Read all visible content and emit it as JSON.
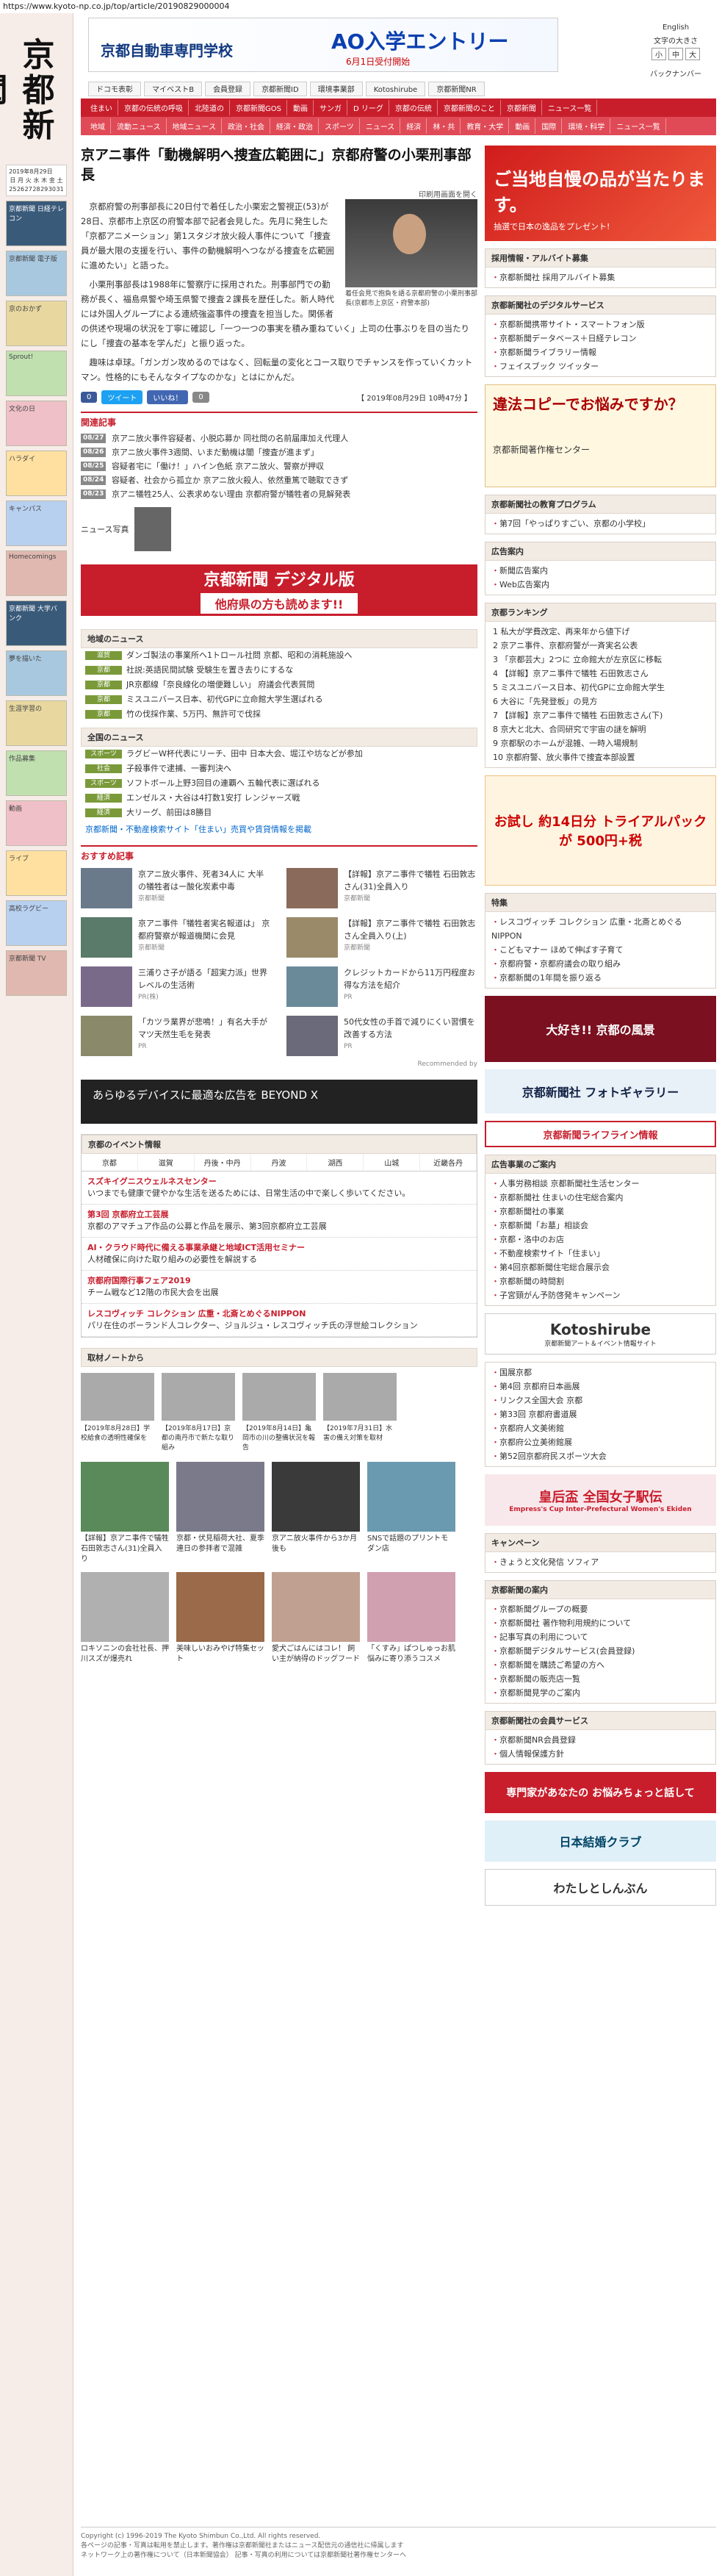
{
  "url": "https://www.kyoto-np.co.jp/top/article/20190829000004",
  "logo": "京都新聞",
  "left": {
    "date": "2019年8月29日",
    "boxes": [
      "京都新聞 日経テレコン",
      "京都新聞 電子版",
      "京のおかず",
      "Sprout!",
      "文化の日",
      "ハラダイ",
      "キャンパス",
      "Homecomings",
      "京都新聞 大学バンク",
      "夢を描いた",
      "生涯学習の",
      "作品募集",
      "動画",
      "ライブ",
      "高校ラグビー",
      "京都新聞 TV"
    ]
  },
  "header": {
    "school": "京都自動車専門学校",
    "ao": "AO入学エントリー",
    "ao_sub": "6月1日受付開始",
    "lang": "English",
    "lang2": "文字の大きさ",
    "backnumber": "バックナンバー"
  },
  "nav1": [
    "ドコモ表彰",
    "マイベストB",
    "会員登録",
    "京都新聞ID",
    "環境事業部",
    "Kotoshirube",
    "京都新聞NR"
  ],
  "nav2": [
    "住まい",
    "京都の伝統の呼吸",
    "北陸道の",
    "京都新聞GOS",
    "動画",
    "サンガ",
    "D リーグ",
    "京都の伝統",
    "京都新聞のこと",
    "京都新聞",
    "ニュース一覧"
  ],
  "nav3": [
    "地域",
    "流動ニュース",
    "地域ニュース",
    "政治・社会",
    "経済・政治",
    "スポーツ",
    "ニュース",
    "経済",
    "林・共",
    "教育・大学",
    "動画",
    "国際",
    "環境・科学",
    "ニュース一覧"
  ],
  "article": {
    "title": "京アニ事件「動機解明へ捜査広範囲に」京都府警の小栗刑事部長",
    "print": "印刷用画面を開く",
    "photo_caption": "着任会見で抱負を語る京都府警の小栗刑事部長(京都市上京区・府警本部)",
    "paragraphs": [
      "京都府警の刑事部長に20日付で着任した小栗宏之警視正(53)が28日、京都市上京区の府警本部で記者会見した。先月に発生した「京都アニメーション」第1スタジオ放火殺人事件について「捜査員が最大限の支援を行い、事件の動機解明へつながる捜査を広範囲に進めたい」と語った。",
      "小栗刑事部長は1988年に警察庁に採用された。刑事部門での勤務が長く、福島県警や埼玉県警で捜査２課長を歴任した。新人時代には外国人グループによる連続強盗事件の捜査を担当した。関係者の供述や現場の状況を丁寧に確認し「一つ一つの事実を積み重ねていく」上司の仕事ぶりを目の当たりにし「捜査の基本を学んだ」と振り返った。",
      "趣味は卓球。「ガンガン攻めるのではなく、回転量の変化とコース取りでチャンスを作っていくカットマン。性格的にもそんなタイプなのかな」とはにかんだ。"
    ],
    "share": [
      "0",
      "ツイート",
      "いいね！",
      "0"
    ],
    "timestamp": "【 2019年08月29日 10時47分 】",
    "related_head": "関連記事",
    "related": [
      {
        "tag": "08/27",
        "text": "京アニ放火事件容疑者、小脱応募か 同社問の名前届庫加え代理人"
      },
      {
        "tag": "08/26",
        "text": "京アニ放火事件3週間、いまだ動機は闇「捜査が進まず」"
      },
      {
        "tag": "08/25",
        "text": "容疑者宅に「働け！」ハイン色紙 京アニ放火、警察が押収"
      },
      {
        "tag": "08/24",
        "text": "容疑者、社会から孤立か 京アニ放火殺人、依然重篤で聴取できず"
      },
      {
        "tag": "08/23",
        "text": "京アニ犠牲25人、公表求めない理由 京都府警が犠牲者の見解発表"
      }
    ],
    "news_person": "ニュース写真"
  },
  "digital_banner": {
    "a": "京都新聞 デジタル版",
    "b": "他府県の方も読めます!!"
  },
  "local_news": {
    "head": "地域のニュース",
    "items": [
      {
        "tag": "滋賀",
        "text": "ダンゴ製法の事業所へ1トロール社問 京都、昭和の消耗施設へ"
      },
      {
        "tag": "京都",
        "text": "社説:英語民間試験 受験生を置き去りにするな"
      },
      {
        "tag": "京都",
        "text": "JR京都線「奈良線化の増便難しい」 府議会代表質問"
      },
      {
        "tag": "京都",
        "text": "ミスユニバース日本、初代GPに立命館大学生選ばれる"
      },
      {
        "tag": "京都",
        "text": "竹の伐採作業、5万円、無許可で伐採"
      }
    ],
    "head2": "全国のニュース",
    "items2": [
      {
        "tag": "スポーツ",
        "text": "ラグビーW杯代表にリーチ、田中 日本大会、堀江や坊などが参加"
      },
      {
        "tag": "社会",
        "text": "子殺事件で逮捕、一審判決へ"
      },
      {
        "tag": "スポーツ",
        "text": "ソフトボール上野3回目の連覇へ 五輪代表に選ばれる"
      },
      {
        "tag": "経済",
        "text": "エンゼルス・大谷は4打数1安打 レンジャーズ戦"
      },
      {
        "tag": "経済",
        "text": "大リーグ、前田は8勝目"
      }
    ],
    "more": "京都新聞・不動産検索サイト「住まい」売買や賃貸情報を掲載"
  },
  "recommend": {
    "head": "おすすめ記事",
    "items": [
      {
        "text": "京アニ放火事件、死者34人に 大半の犠牲者はー酸化炭素中毒",
        "src": "京都新聞"
      },
      {
        "text": "【詳報】京アニ事件で犠牲 石田敦志さん(31)全員入り",
        "src": "京都新聞"
      },
      {
        "text": "京アニ事件「犠牲者実名報道は」 京都府警察が報道機関に会見",
        "src": "京都新聞"
      },
      {
        "text": "【詳報】京アニ事件で犠牲 石田敦志さん全員入り(上)",
        "src": "京都新聞"
      },
      {
        "text": "三浦りさ子が語る「超実力派」世界レベルの生活術",
        "src": "PR(株)"
      },
      {
        "text": "クレジットカードから11万円程度お得な方法を紹介",
        "src": "PR"
      },
      {
        "text": "「カツラ業界が悲鳴！」有名大手がマツ天然生毛を発表",
        "src": "PR"
      },
      {
        "text": "50代女性の手首で減りにくい習慣を改善する方法",
        "src": "PR"
      }
    ],
    "recommended_by": "Recommended by"
  },
  "beyond": "あらゆるデバイスに最適な広告を BEYOND X",
  "events": {
    "head": "京都のイベント情報",
    "tabs": [
      "京都",
      "滋賀",
      "丹後・中丹",
      "丹波",
      "湖西",
      "山城",
      "近畿各丹"
    ],
    "items": [
      {
        "h": "スズキイグニスウェルネスセンター",
        "t": "いつまでも健康で健やかな生活を送るためには、日常生活の中で楽しく歩いてください。"
      },
      {
        "h": "第3回 京都府立工芸展",
        "t": "京都のアマチュア作品の公募と作品を展示、第3回京都府立工芸展"
      },
      {
        "h": "AI・クラウド時代に備える事業承継と地域ICT活用セミナー",
        "t": "人材確保に向けた取り組みの必要性を解説する"
      },
      {
        "h": "京都府国際行事フェア2019",
        "t": "チーム戦など12階の市民大会を出展"
      },
      {
        "h": "レスコヴィッチ コレクション 広重・北斎とめぐるNIPPON",
        "t": "パリ在住のボーランド人コレクター、ジョルジュ・レスコヴィッチ氏の浮世絵コレクション"
      }
    ]
  },
  "notes": {
    "head": "取材ノートから",
    "items": [
      "【2019年8月28日】学校給食の透明性確保を",
      "【2019年8月17日】京都の南丹市で新たな取り組み",
      "【2019年8月14日】亀岡市の川の整備状況を報告",
      "【2019年7月31日】水害の備え対策を取材"
    ]
  },
  "grid": [
    "【詳報】京アニ事件で犠牲 石田敦志さん(31)全員入り",
    "京都・伏見稲荷大社、夏季連日の参拝者で混雑",
    "京アニ放火事件から3か月後も",
    "SNSで話題のプリントモダン店",
    "ロキソニンの会社社長、押川スズが爆売れ",
    "美味しいおみやげ特集セット",
    "愛犬ごはんにはコレ！ 飼い主が納得のドッグフード",
    "「くすみ」ぱつしゅっお肌悩みに寄り添うコスメ"
  ],
  "sidebar": {
    "ad1_title": "ご当地自慢の品が当たります。",
    "ad1_sub": "抽選で日本の逸品をプレゼント!",
    "recruit_head": "採用情報・アルバイト募集",
    "recruit": [
      "京都新聞社 採用アルバイト募集"
    ],
    "digital_head": "京都新聞社のデジタルサービス",
    "digital": [
      "京都新聞携帯サイト・スマートフォン版",
      "京都新聞データベース＋日経テレコン",
      "京都新聞ライブラリー情報",
      "フェイスブック ツイッター"
    ],
    "copy_title": "違法コピーでお悩みですか？",
    "copy_sub": "京都新聞著作権センター",
    "edu_head": "京都新聞社の教育プログラム",
    "edu": [
      "第7回「やっぱりすごい、京都の小学校」"
    ],
    "ad_head": "広告案内",
    "ad": [
      "新聞広告案内",
      "Web広告案内"
    ],
    "rank_head": "京都ランキング",
    "rank": [
      "1 私大が学費改定、再来年から値下げ",
      "2 京アニ事件、京都府警が一斉実名公表",
      "3 「京都芸大」2つに 立命館大が左京区に移転",
      "4 【詳報】京アニ事件で犠牲 石田敦志さん",
      "5 ミスユニバース日本、初代GPに立命館大学生",
      "6 大谷に「先発登板」の見方",
      "7 【詳報】京アニ事件で犠牲 石田敦志さん(下)",
      "8 京大と北大、合同研究で宇宙の謎を解明",
      "9 京都駅のホームが混雑、一時入場規制",
      "10 京都府警、放火事件で捜査本部設置"
    ],
    "pharma_ad": "お試し 約14日分 トライアルパックが 500円+税",
    "special_head": "特集",
    "special": [
      "レスコヴィッチ コレクション 広重・北斎とめぐるNIPPON",
      "こどもマナー ほめて伸ばす子育て",
      "京都府警・京都府議会の取り組み",
      "京都新聞の1年間を振り返る"
    ],
    "photo_contest": "大好き!! 京都の風景",
    "photo_gallery": "京都新聞社 フォトギャラリー",
    "life_ban": "京都新聞ライフライン情報",
    "info_head": "広告事業のご案内",
    "info": [
      "人事労務相談 京都新聞社生活センター",
      "京都新聞社 住まいの住宅総合案内",
      "京都新聞社の事業",
      "京都新聞「お墓」相談会",
      "京都・洛中のお店",
      "不動産検索サイト「住まい」",
      "第4回京都新聞住宅総合展示会",
      "京都新聞の時間割",
      "子宮頸がん予防啓発キャンペーン"
    ],
    "kotoshirube": "Kotoshirube",
    "kotoshirube_sub": "京都新聞アート＆イベント情報サイト",
    "kt_list": [
      "国展京都",
      "第4回 京都府日本画展",
      "リンクス全国大会 京都",
      "第33回 京都府書道展",
      "京都府人文美術館",
      "京都府公立美術館展",
      "第52回京都府民スポーツ大会"
    ],
    "ekiden": "皇后盃 全国女子駅伝",
    "ekiden_sub": "Empress's Cup Inter-Prefectural Women's Ekiden",
    "campaign_head": "キャンペーン",
    "campaign": [
      "きょうと文化発信 ソフィア"
    ],
    "guide_head": "京都新聞の案内",
    "guide": [
      "京都新聞グループの概要",
      "京都新聞社 著作物利用規約について",
      "記事写真の利用について",
      "京都新聞デジタルサービス(会員登録)",
      "京都新聞を購読ご希望の方へ",
      "京都新聞の販売店一覧",
      "京都新聞見学のご案内"
    ],
    "guide_head2": "京都新聞社の会員サービス",
    "guide2": [
      "京都新聞NR会員登録",
      "個人情報保護方針"
    ],
    "bottom1": "専門家があなたの お悩みちょっと話して",
    "bottom2": "日本結婚クラブ",
    "bottom3": "わたしとしんぶん"
  },
  "footer": {
    "copyright": "Copyright (c) 1996-2019 The Kyoto Shimbun Co.,Ltd. All rights reserved.",
    "note1": "各ページの記事・写真は転用を禁止します。著作権は京都新聞社またはニュース配信元の通信社に帰属します",
    "note2": "ネットワーク上の著作権について（日本新聞協会） 記事・写真の利用については京都新聞社著作権センターへ"
  },
  "colors": {
    "brand": "#c81e2c",
    "accent": "#e04a56"
  }
}
